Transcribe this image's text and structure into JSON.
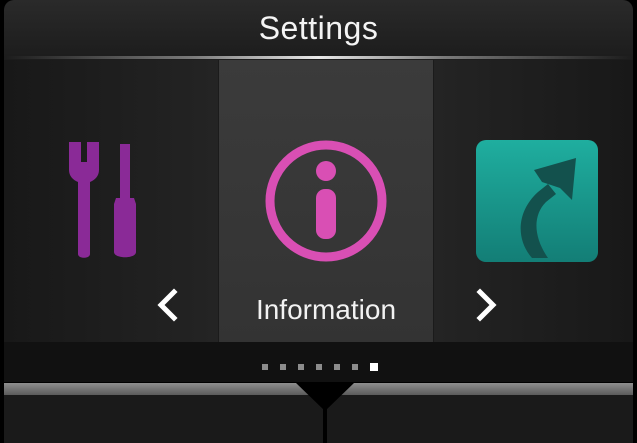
{
  "header": {
    "title": "Settings"
  },
  "carousel": {
    "selected_index": 1,
    "items": [
      {
        "icon": "wrench-screwdriver-icon",
        "label": ""
      },
      {
        "icon": "info-icon",
        "label": "Information"
      },
      {
        "icon": "return-arrow-icon",
        "label": ""
      }
    ]
  },
  "nav": {
    "prev_icon": "chevron-left-icon",
    "next_icon": "chevron-right-icon"
  },
  "pagination": {
    "page_count": 7,
    "current_page": 7
  },
  "colors": {
    "accent_purple": "#8a2a97",
    "info_pink": "#d94fb4",
    "teal": "#1b9a8f",
    "text": "#f2f2f2"
  }
}
